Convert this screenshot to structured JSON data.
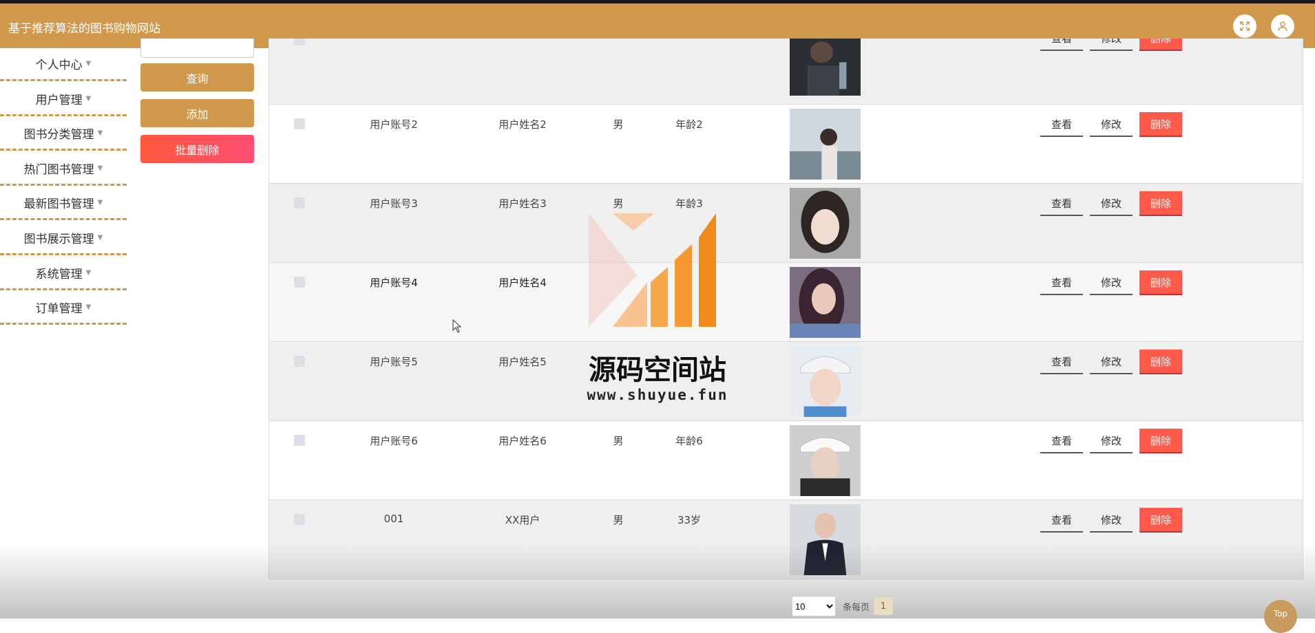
{
  "app": {
    "title": "基于推荐算法的图书购物网站"
  },
  "topbar": {
    "fullscreen_icon": "fullscreen-icon",
    "user_icon": "user-icon"
  },
  "sidebar": {
    "items": [
      {
        "label": "个人中心"
      },
      {
        "label": "用户管理"
      },
      {
        "label": "图书分类管理"
      },
      {
        "label": "热门图书管理"
      },
      {
        "label": "最新图书管理"
      },
      {
        "label": "图书展示管理"
      },
      {
        "label": "系统管理"
      },
      {
        "label": "订单管理"
      }
    ]
  },
  "actions": {
    "query": "查询",
    "add": "添加",
    "batch_delete": "批量删除"
  },
  "table": {
    "buttons": {
      "view": "查看",
      "edit": "修改",
      "delete": "删除"
    },
    "rows": [
      {
        "account": "",
        "name": "",
        "gender": "",
        "age": "",
        "avatar": "avatar-photo-1"
      },
      {
        "account": "用户账号2",
        "name": "用户姓名2",
        "gender": "男",
        "age": "年龄2",
        "avatar": "avatar-photo-2"
      },
      {
        "account": "用户账号3",
        "name": "用户姓名3",
        "gender": "男",
        "age": "年龄3",
        "avatar": "avatar-photo-3"
      },
      {
        "account": "用户账号4",
        "name": "用户姓名4",
        "gender": "",
        "age": "",
        "avatar": "avatar-photo-4"
      },
      {
        "account": "用户账号5",
        "name": "用户姓名5",
        "gender": "",
        "age": "",
        "avatar": "avatar-photo-5"
      },
      {
        "account": "用户账号6",
        "name": "用户姓名6",
        "gender": "男",
        "age": "年龄6",
        "avatar": "avatar-photo-6"
      },
      {
        "account": "001",
        "name": "XX用户",
        "gender": "男",
        "age": "33岁",
        "avatar": "avatar-photo-7"
      }
    ]
  },
  "pagination": {
    "page_size": "10",
    "per_page_label": "条每页",
    "current_page": "1"
  },
  "top_button": {
    "label": "Top"
  },
  "watermark": {
    "title": "源码空间站",
    "url": "www.shuyue.fun"
  },
  "colors": {
    "brand": "#d0984b",
    "danger": "#ff5a4a"
  }
}
